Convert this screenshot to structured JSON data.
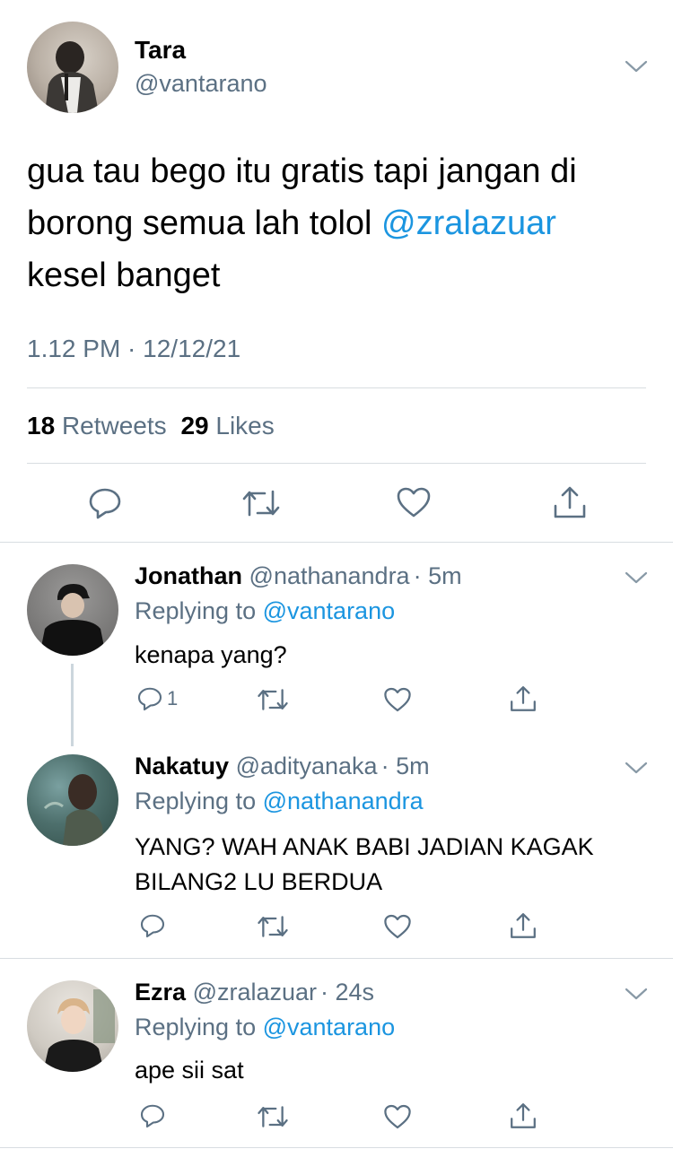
{
  "tweet": {
    "author_name": "Tara",
    "author_handle": "@vantarano",
    "text_line1": "gua tau bego itu gratis tapi jangan di",
    "text_line2_plain": "borong semua lah tolol ",
    "text_mention": "@zralazuar",
    "text_line3": "kesel banget",
    "timestamp": "1.12 PM · 12/12/21",
    "retweets_count": "18",
    "retweets_label": "Retweets",
    "likes_count": "29",
    "likes_label": "Likes"
  },
  "replies": [
    {
      "name": "Jonathan",
      "handle": "@nathanandra",
      "time": "· 5m",
      "replying_label": "Replying to",
      "replying_handle": "@vantarano",
      "text": "kenapa yang?",
      "reply_count": "1"
    },
    {
      "name": "Nakatuy",
      "handle": "@adityanaka",
      "time": "· 5m",
      "replying_label": "Replying to",
      "replying_handle": "@nathanandra",
      "text_line1": "YANG? WAH ANAK BABI JADIAN KAGAK",
      "text_line2": "BILANG2 LU BERDUA"
    },
    {
      "name": "Ezra",
      "handle": "@zralazuar",
      "time": "· 24s",
      "replying_label": "Replying to",
      "replying_handle": "@vantarano",
      "text": "ape sii sat"
    }
  ],
  "colors": {
    "link": "#1b95e0",
    "secondary_text": "#5b7083",
    "divider": "#d8dde1",
    "icon": "#5b7083"
  },
  "icons": {
    "reply": "reply-icon",
    "retweet": "retweet-icon",
    "like": "heart-icon",
    "share": "share-icon",
    "more": "chevron-down-icon"
  }
}
